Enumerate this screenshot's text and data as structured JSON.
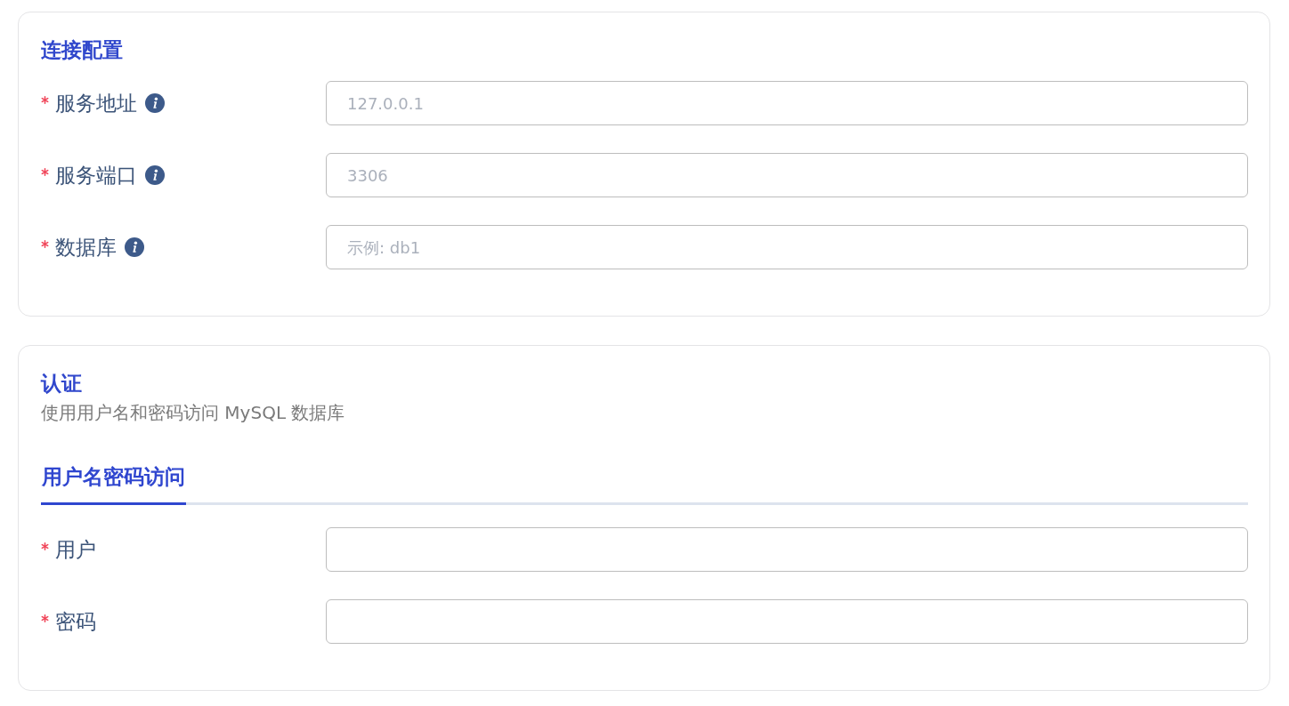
{
  "sections": [
    {
      "title": "连接配置",
      "fields": [
        {
          "label": "服务地址",
          "required": true,
          "info": true,
          "placeholder": "127.0.0.1"
        },
        {
          "label": "服务端口",
          "required": true,
          "info": true,
          "placeholder": "3306"
        },
        {
          "label": "数据库",
          "required": true,
          "info": true,
          "placeholder": "示例: db1"
        }
      ]
    },
    {
      "title": "认证",
      "description": "使用用户名和密码访问 MySQL 数据库",
      "tabs": [
        {
          "label": "用户名密码访问",
          "selected": true
        }
      ],
      "fields": [
        {
          "label": "用户",
          "required": true,
          "info": false
        },
        {
          "label": "密码",
          "required": true,
          "info": false
        }
      ]
    }
  ]
}
